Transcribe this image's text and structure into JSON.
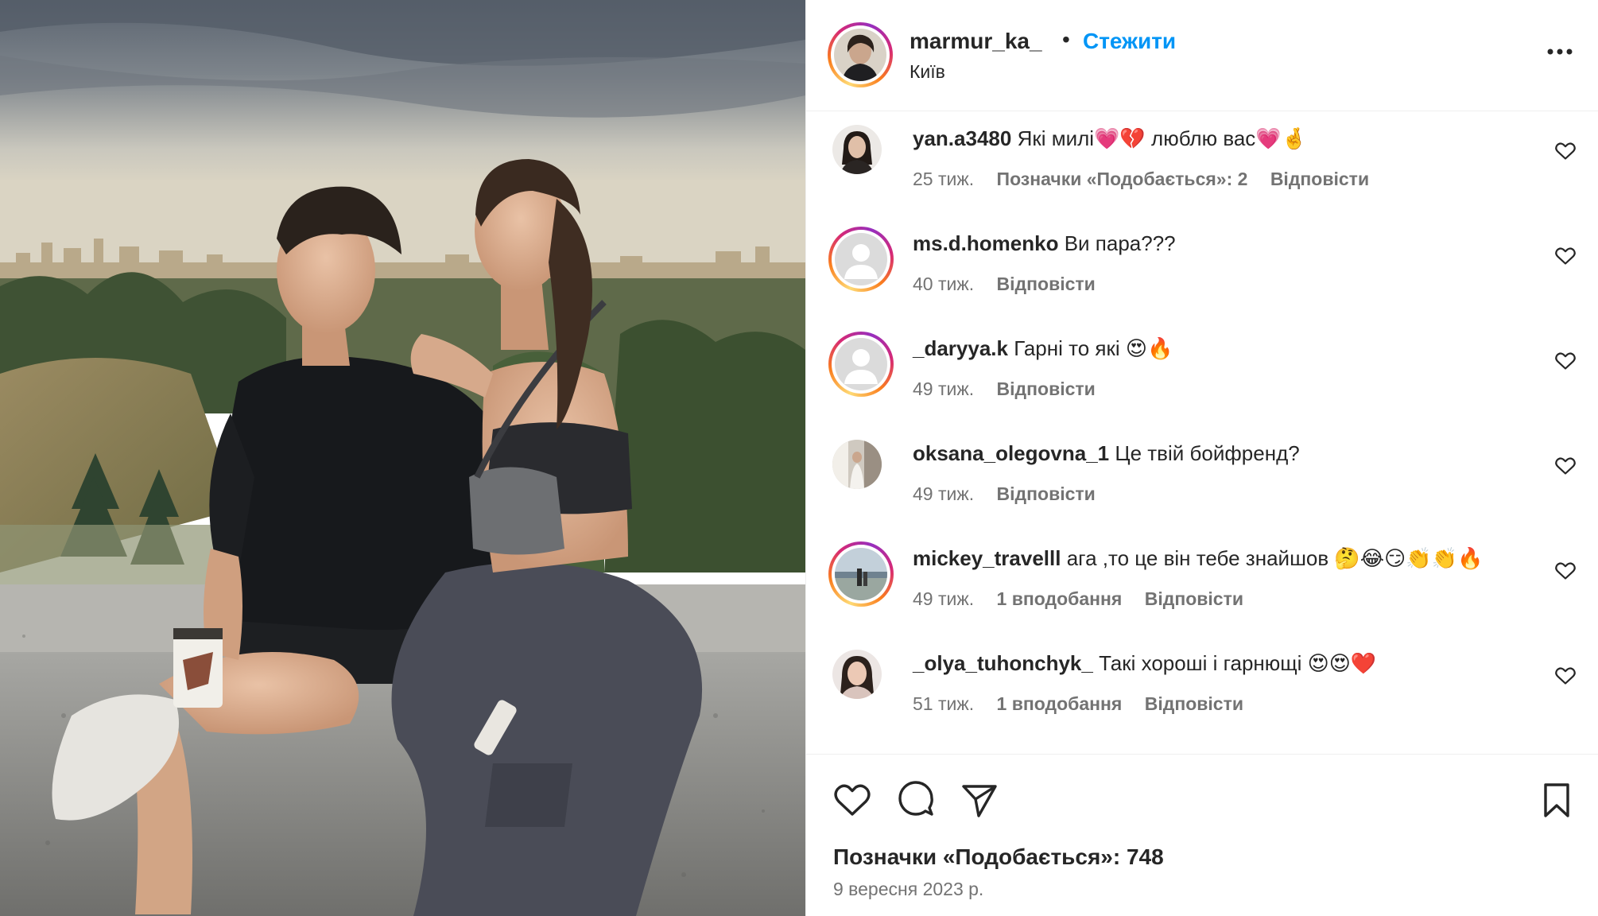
{
  "post": {
    "username": "marmur_ka_",
    "separator": "•",
    "follow_label": "Стежити",
    "location": "Київ",
    "more_icon": "more-horizontal-icon"
  },
  "comments": [
    {
      "user": "yan.a3480",
      "text": "Які милі💗💔 люблю вас💗🤞",
      "time": "25 тиж.",
      "likes": "Позначки «Подобається»: 2",
      "reply": "Відповісти",
      "avatar": "photo",
      "story_ring": false
    },
    {
      "user": "ms.d.homenko",
      "text": "Ви пара???",
      "time": "40 тиж.",
      "likes": "",
      "reply": "Відповісти",
      "avatar": "default",
      "story_ring": true
    },
    {
      "user": "_daryya.k",
      "text": "Гарні то які 😍🔥",
      "time": "49 тиж.",
      "likes": "",
      "reply": "Відповісти",
      "avatar": "default",
      "story_ring": true
    },
    {
      "user": "oksana_olegovna_1",
      "text": "Це твій бойфренд?",
      "time": "49 тиж.",
      "likes": "",
      "reply": "Відповісти",
      "avatar": "photo",
      "story_ring": false
    },
    {
      "user": "mickey_travelll",
      "text": "ага ,то це він тебе знайшов 🤔😂😏👏👏🔥",
      "time": "49 тиж.",
      "likes": "1 вподобання",
      "reply": "Відповісти",
      "avatar": "photo",
      "story_ring": true
    },
    {
      "user": "_olya_tuhonchyk_",
      "text": "Такі хороші і гарнющі 😍😍❤️",
      "time": "51 тиж.",
      "likes": "1 вподобання",
      "reply": "Відповісти",
      "avatar": "photo",
      "story_ring": false
    }
  ],
  "actions": {
    "like_icon": "heart-icon",
    "comment_icon": "comment-icon",
    "share_icon": "share-icon",
    "save_icon": "bookmark-icon",
    "likes_text": "Позначки «Подобається»: 748",
    "date": "9 вересня 2023 р."
  },
  "colors": {
    "accent": "#0095f6",
    "text": "#262626",
    "secondary": "#737373",
    "divider": "#efefef"
  }
}
